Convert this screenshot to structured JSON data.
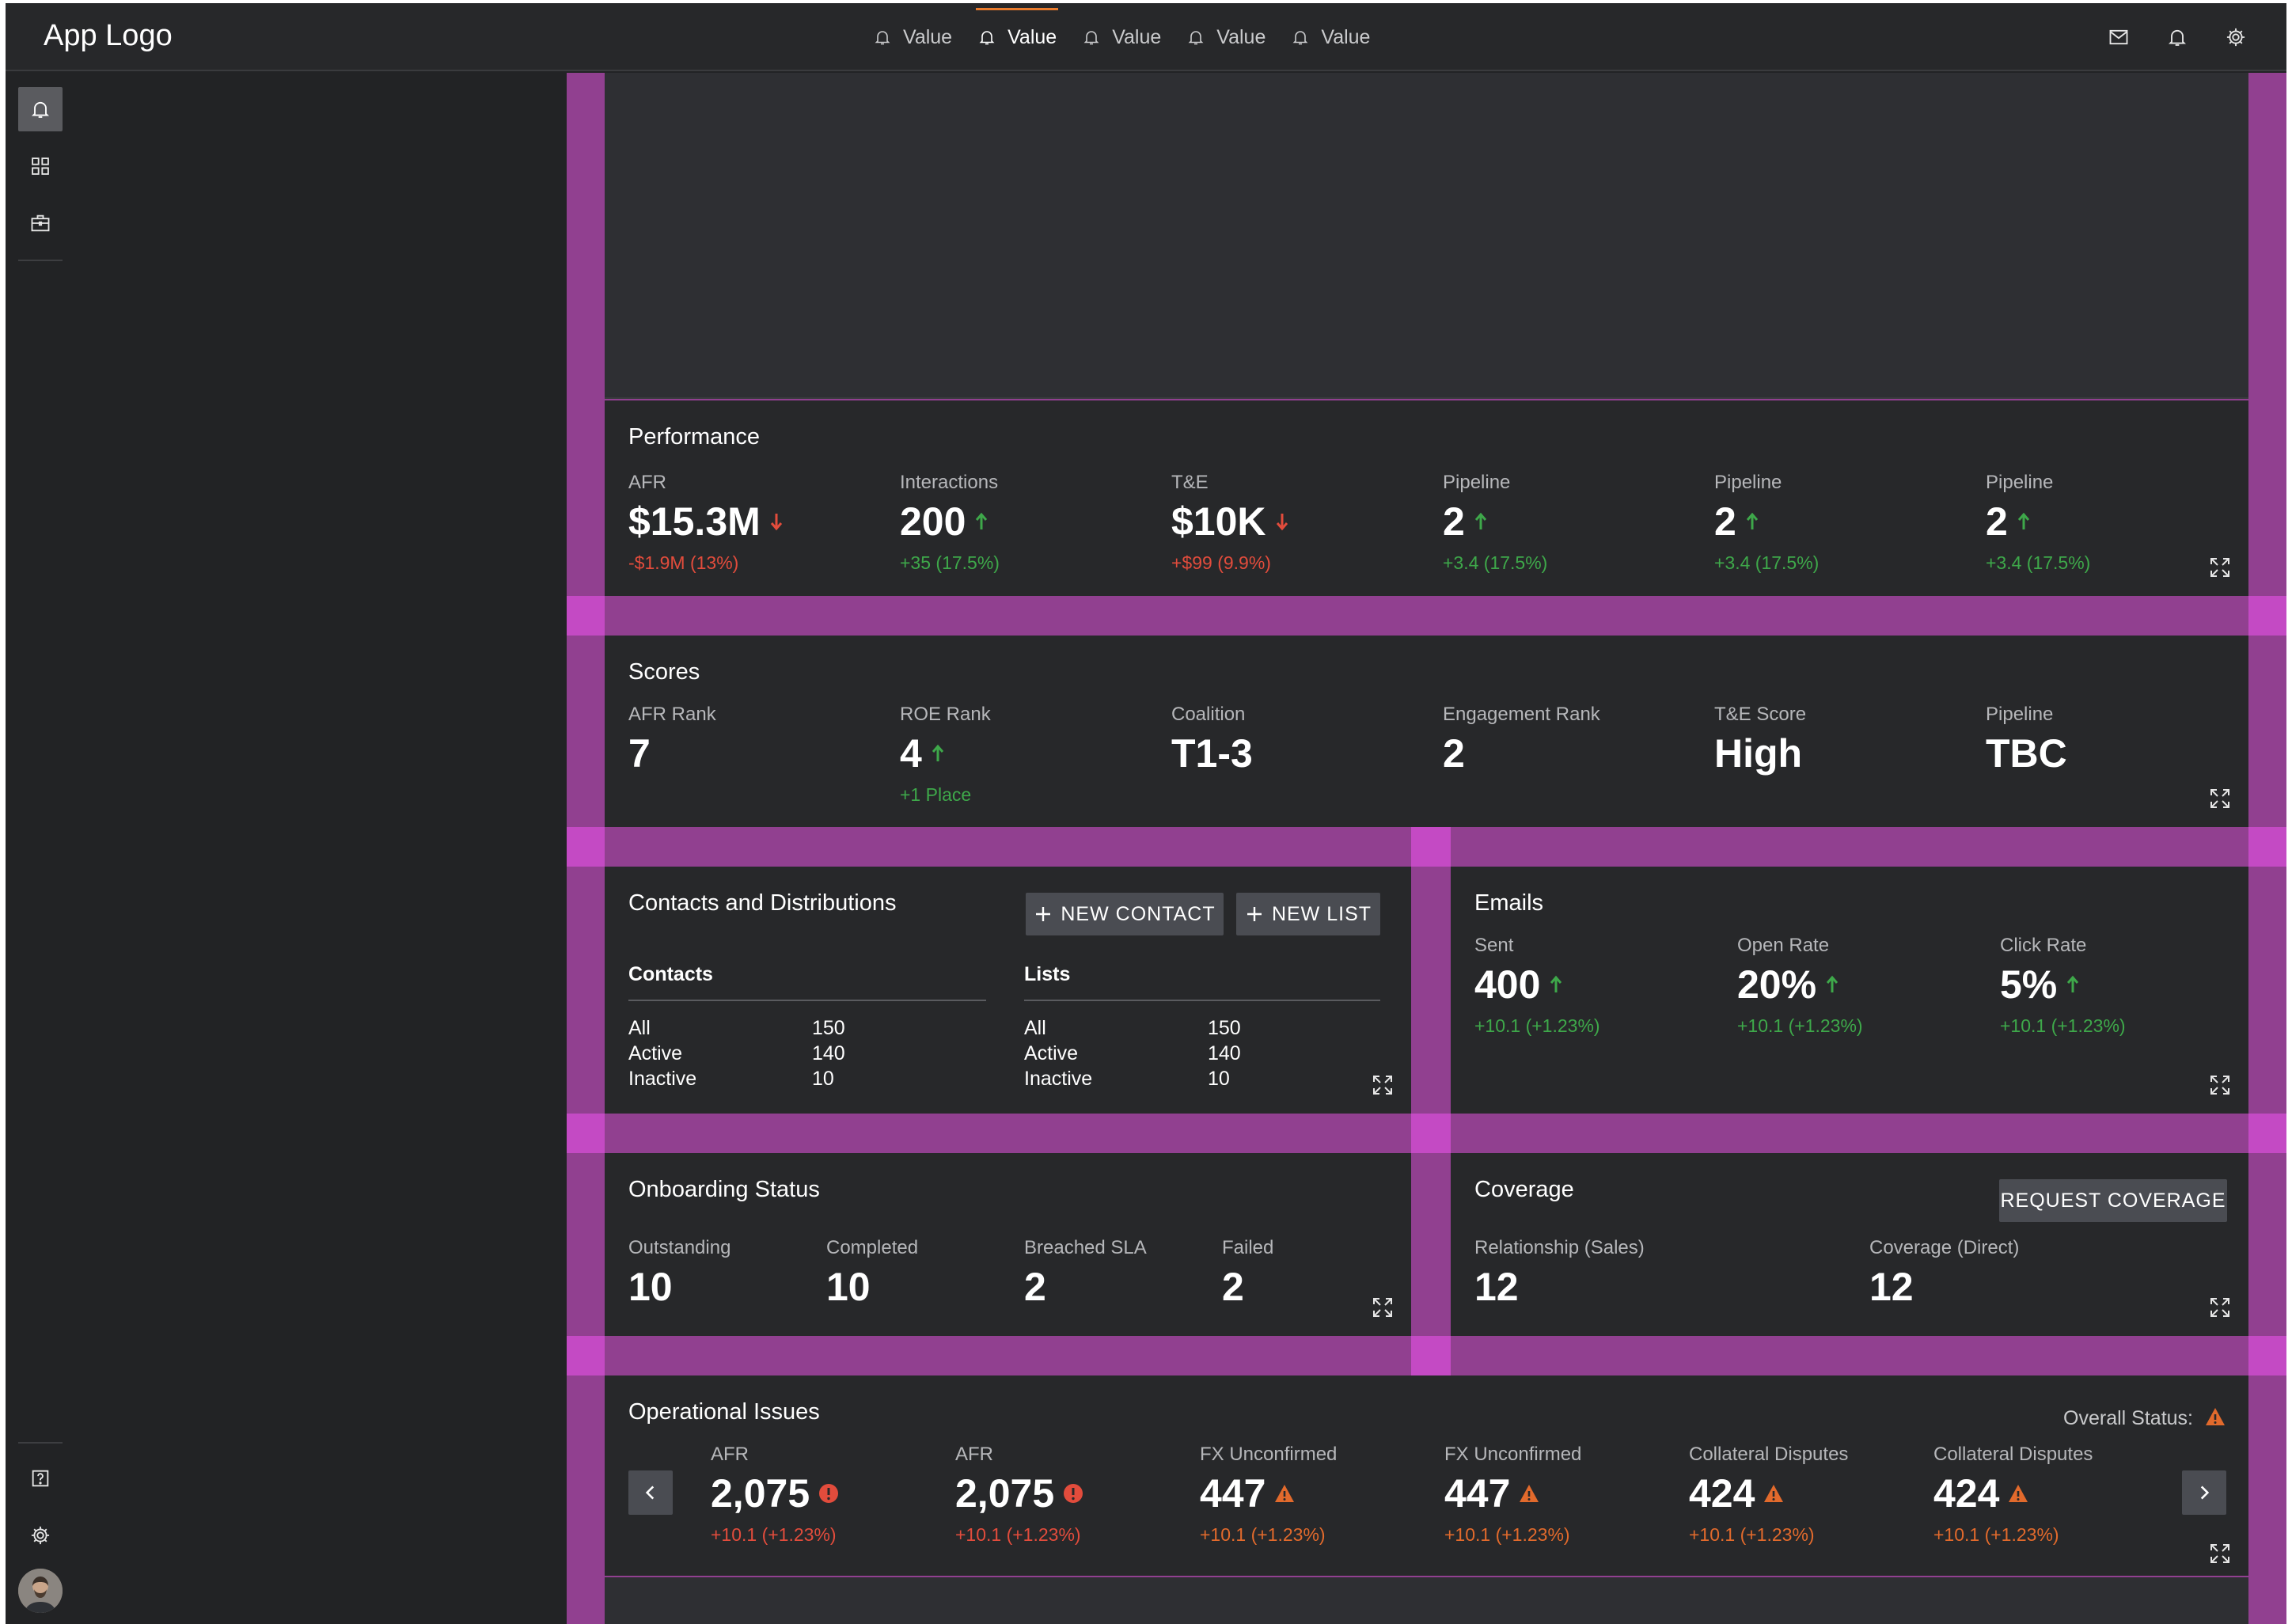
{
  "app": {
    "logo": "App Logo"
  },
  "topnav": {
    "tabs": [
      {
        "label": "Value",
        "active": false
      },
      {
        "label": "Value",
        "active": true
      },
      {
        "label": "Value",
        "active": false
      },
      {
        "label": "Value",
        "active": false
      },
      {
        "label": "Value",
        "active": false
      }
    ],
    "icons": [
      "mail-icon",
      "bell-icon",
      "gear-icon"
    ]
  },
  "rail": {
    "top_icons": [
      "bell-icon",
      "grid-icon",
      "briefcase-icon"
    ],
    "bottom_icons": [
      "help-icon",
      "gear-icon"
    ]
  },
  "colors": {
    "up": "#3ea84a",
    "down": "#e24c3c",
    "warn": "#e26a2c",
    "accent": "#e97b2d",
    "layout_guide": "#914090"
  },
  "performance": {
    "title": "Performance",
    "metrics": [
      {
        "label": "AFR",
        "value": "$15.3M",
        "trend": "down",
        "change": "-$1.9M (13%)"
      },
      {
        "label": "Interactions",
        "value": "200",
        "trend": "up",
        "change": "+35 (17.5%)"
      },
      {
        "label": "T&E",
        "value": "$10K",
        "trend": "down",
        "change": "+$99 (9.9%)"
      },
      {
        "label": "Pipeline",
        "value": "2",
        "trend": "up",
        "change": "+3.4 (17.5%)"
      },
      {
        "label": "Pipeline",
        "value": "2",
        "trend": "up",
        "change": "+3.4 (17.5%)"
      },
      {
        "label": "Pipeline",
        "value": "2",
        "trend": "up",
        "change": "+3.4 (17.5%)"
      }
    ]
  },
  "scores": {
    "title": "Scores",
    "metrics": [
      {
        "label": "AFR Rank",
        "value": "7"
      },
      {
        "label": "ROE Rank",
        "value": "4",
        "trend": "up",
        "change": "+1 Place"
      },
      {
        "label": "Coalition",
        "value": "T1-3"
      },
      {
        "label": "Engagement Rank",
        "value": "2"
      },
      {
        "label": "T&E Score",
        "value": "High"
      },
      {
        "label": "Pipeline",
        "value": "TBC"
      }
    ]
  },
  "contacts": {
    "title": "Contacts and Distributions",
    "new_contact": "NEW CONTACT",
    "new_list": "NEW LIST",
    "contacts_head": "Contacts",
    "lists_head": "Lists",
    "contacts_rows": [
      {
        "label": "All",
        "value": "150"
      },
      {
        "label": "Active",
        "value": "140"
      },
      {
        "label": "Inactive",
        "value": "10"
      }
    ],
    "lists_rows": [
      {
        "label": "All",
        "value": "150"
      },
      {
        "label": "Active",
        "value": "140"
      },
      {
        "label": "Inactive",
        "value": "10"
      }
    ]
  },
  "emails": {
    "title": "Emails",
    "metrics": [
      {
        "label": "Sent",
        "value": "400",
        "trend": "up",
        "change": "+10.1 (+1.23%)"
      },
      {
        "label": "Open Rate",
        "value": "20%",
        "trend": "up",
        "change": "+10.1 (+1.23%)"
      },
      {
        "label": "Click Rate",
        "value": "5%",
        "trend": "up",
        "change": "+10.1 (+1.23%)"
      }
    ]
  },
  "onboarding": {
    "title": "Onboarding Status",
    "metrics": [
      {
        "label": "Outstanding",
        "value": "10"
      },
      {
        "label": "Completed",
        "value": "10"
      },
      {
        "label": "Breached SLA",
        "value": "2"
      },
      {
        "label": "Failed",
        "value": "2"
      }
    ]
  },
  "coverage": {
    "title": "Coverage",
    "button": "REQUEST COVERAGE",
    "metrics": [
      {
        "label": "Relationship (Sales)",
        "value": "12"
      },
      {
        "label": "Coverage (Direct)",
        "value": "12"
      }
    ]
  },
  "operational": {
    "title": "Operational Issues",
    "overall_status_label": "Overall Status:",
    "metrics": [
      {
        "label": "AFR",
        "value": "2,075",
        "severity": "error",
        "change": "+10.1 (+1.23%)"
      },
      {
        "label": "AFR",
        "value": "2,075",
        "severity": "error",
        "change": "+10.1 (+1.23%)"
      },
      {
        "label": "FX Unconfirmed",
        "value": "447",
        "severity": "warning",
        "change": "+10.1 (+1.23%)"
      },
      {
        "label": "FX Unconfirmed",
        "value": "447",
        "severity": "warning",
        "change": "+10.1 (+1.23%)"
      },
      {
        "label": "Collateral Disputes",
        "value": "424",
        "severity": "warning",
        "change": "+10.1 (+1.23%)"
      },
      {
        "label": "Collateral Disputes",
        "value": "424",
        "severity": "warning",
        "change": "+10.1 (+1.23%)"
      }
    ]
  }
}
